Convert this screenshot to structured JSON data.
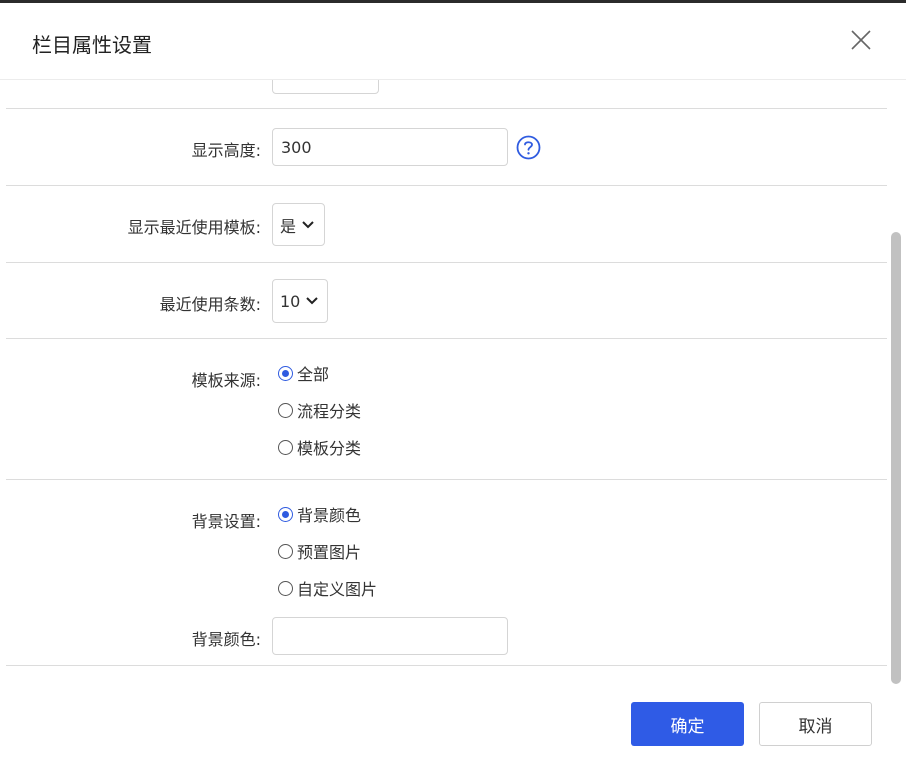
{
  "dialog": {
    "title": "栏目属性设置",
    "close_icon": "close-icon"
  },
  "form": {
    "display_height": {
      "label": "显示高度:",
      "value": "300",
      "help_icon": "help-circle-icon"
    },
    "show_recent_templates": {
      "label": "显示最近使用模板:",
      "selected": "是"
    },
    "recent_count": {
      "label": "最近使用条数:",
      "selected": "10"
    },
    "template_source": {
      "label": "模板来源:",
      "options": [
        "全部",
        "流程分类",
        "模板分类"
      ],
      "selected_index": 0
    },
    "background_setting": {
      "label": "背景设置:",
      "options": [
        "背景颜色",
        "预置图片",
        "自定义图片"
      ],
      "selected_index": 0
    },
    "background_color": {
      "label": "背景颜色:",
      "value": ""
    }
  },
  "footer": {
    "ok_label": "确定",
    "cancel_label": "取消"
  },
  "colors": {
    "primary": "#2f5be6",
    "help_icon": "#2f5be0"
  }
}
